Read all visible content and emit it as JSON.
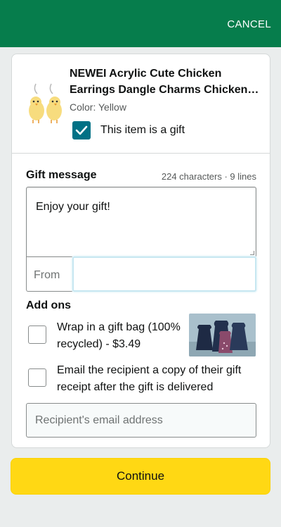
{
  "header": {
    "cancel_label": "CANCEL",
    "bar_color": "#067d4c"
  },
  "product": {
    "title_line1": "NEWEI Acrylic Cute Chicken",
    "title_line2": "Earrings Dangle Charms Chicken Earrings",
    "color_text": "Color: Yellow",
    "image_icon": "chicken-earrings-image"
  },
  "gift_option": {
    "label": "This item is a gift",
    "checked": true
  },
  "gift_message": {
    "label": "Gift message",
    "counter": "224 characters · 9 lines",
    "value": "Enjoy your gift!",
    "from_label": "From",
    "from_value": ""
  },
  "addons": {
    "heading": "Add ons",
    "items": [
      {
        "label": "Wrap in a gift bag (100% recycled) - $3.49",
        "checked": false,
        "image_icon": "gift-bags-image"
      },
      {
        "label": "Email the recipient a copy of their gift receipt after the gift is delivered",
        "checked": false
      }
    ],
    "email_placeholder": "Recipient's email address"
  },
  "continue_label": "Continue",
  "colors": {
    "accent": "#007185",
    "button": "#ffd814"
  }
}
